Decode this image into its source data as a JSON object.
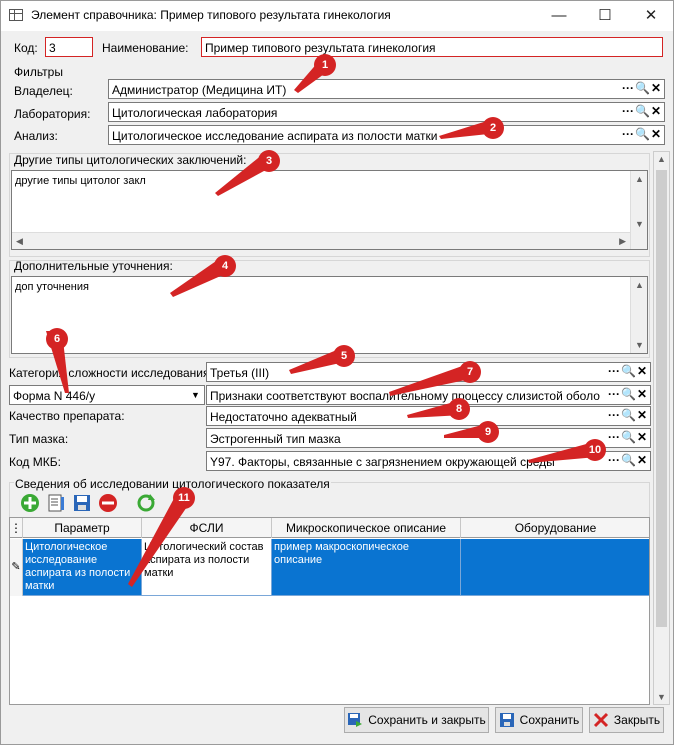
{
  "window": {
    "title": "Элемент справочника: Пример типового результата гинекология",
    "minimize": "—",
    "maximize": "☐",
    "close": "✕"
  },
  "header": {
    "code_label": "Код:",
    "code_value": "3",
    "name_label": "Наименование:",
    "name_value": "Пример типового результата гинекология"
  },
  "filters": {
    "title": "Фильтры",
    "owner_label": "Владелец:",
    "owner_value": "Администратор (Медицина ИТ)",
    "lab_label": "Лаборатория:",
    "lab_value": "Цитологическая лаборатория",
    "analysis_label": "Анализ:",
    "analysis_value": "Цитологическое исследование аспирата из полости матки"
  },
  "ref_buttons": {
    "more": "···",
    "search": "🔍",
    "clear": "✕"
  },
  "other_types": {
    "title": "Другие типы цитологических заключений:",
    "value": "другие типы цитолог закл"
  },
  "extra": {
    "title": "Дополнительные уточнения:",
    "value": "доп уточнения"
  },
  "complexity": {
    "label": "Категория сложности исследования:",
    "value": "Третья (III)"
  },
  "form": {
    "value": "Форма N 446/у",
    "signs_value": "Признаки соответствуют воспалительному процессу слизистой оболочки (ва"
  },
  "quality": {
    "label": "Качество препарата:",
    "value": "Недостаточно адекватный"
  },
  "smear": {
    "label": "Тип мазка:",
    "value": "Эстрогенный тип мазка"
  },
  "mkb": {
    "label": "Код МКБ:",
    "value": "Y97. Факторы, связанные с загрязнением окружающей среды"
  },
  "indicators": {
    "title": "Сведения об исследовании цитологического показателя"
  },
  "grid": {
    "columns": [
      "Параметр",
      "ФСЛИ",
      "Микроскопическое описание",
      "Оборудование"
    ],
    "rows": [
      {
        "param": "Цитологическое исследование аспирата из полости матки",
        "fsli": "Цитологический состав аспирата из полости матки",
        "micro": "пример макроскопическое описание",
        "equipment": ""
      }
    ]
  },
  "buttons": {
    "save_close": "Сохранить и закрыть",
    "save": "Сохранить",
    "close": "Закрыть"
  },
  "markers": [
    "1",
    "2",
    "3",
    "4",
    "5",
    "6",
    "7",
    "8",
    "9",
    "10",
    "11"
  ],
  "colors": {
    "accent": "#0a74d1",
    "marker": "#d42424",
    "required_border": "#d42424"
  }
}
